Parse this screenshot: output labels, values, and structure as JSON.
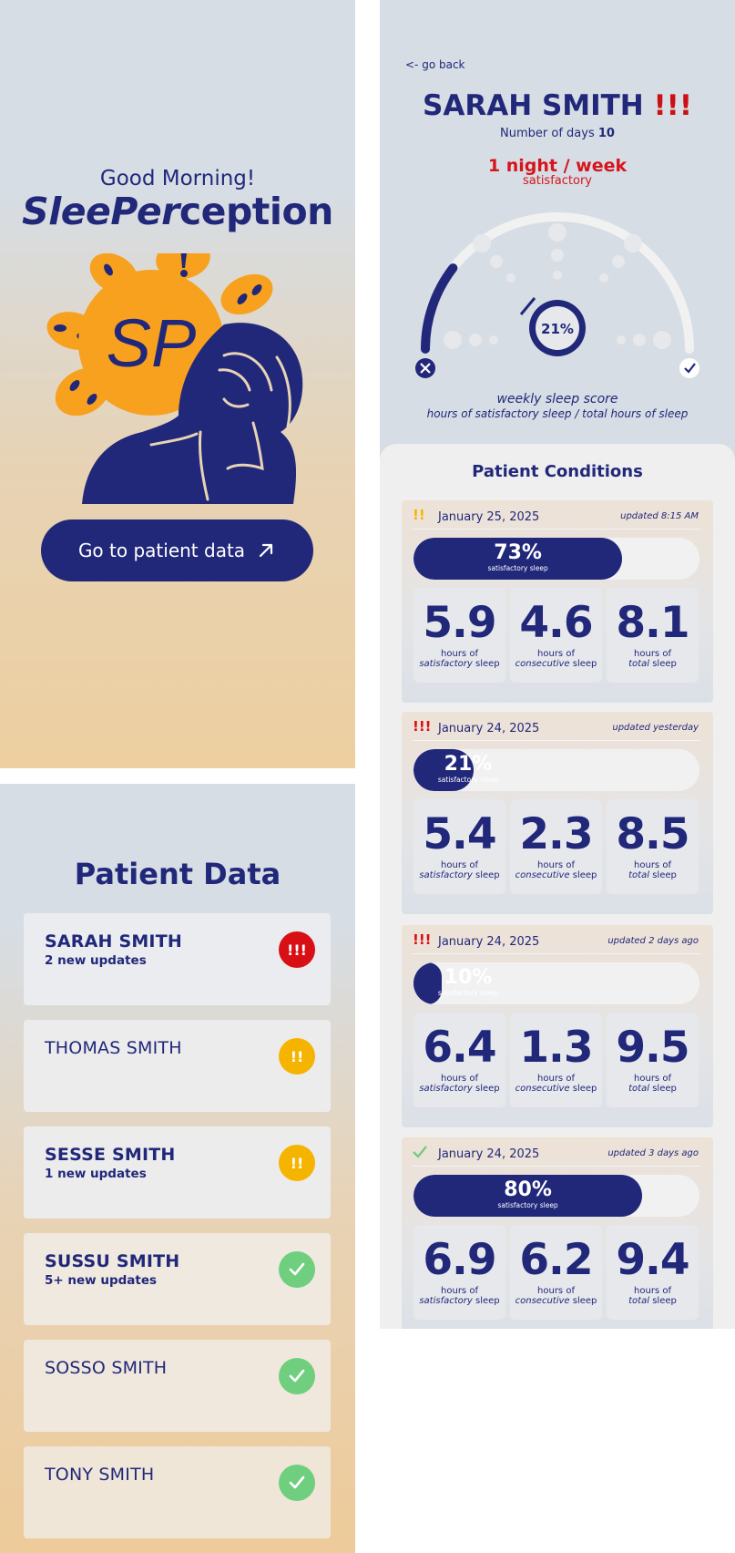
{
  "welcome": {
    "greeting": "Good Morning!",
    "brand_italic": "SleePer",
    "brand_rest": "ception",
    "logo_initials": "SP",
    "cta_label": "Go to patient data",
    "cta_icon": "arrow-up-right-icon"
  },
  "patient_list": {
    "title": "Patient Data",
    "patients": [
      {
        "name": "SARAH SMITH",
        "updates": "2 new updates",
        "status": "critical",
        "badge": "!!!"
      },
      {
        "name": "THOMAS SMITH",
        "updates": "",
        "status": "warning",
        "badge": "!!"
      },
      {
        "name": "SESSE SMITH",
        "updates": "1 new updates",
        "status": "warning",
        "badge": "!!"
      },
      {
        "name": "SUSSU SMITH",
        "updates": "5+ new updates",
        "status": "ok",
        "badge": "check-icon"
      },
      {
        "name": "SOSSO SMITH",
        "updates": "",
        "status": "ok",
        "badge": "check-icon"
      },
      {
        "name": "TONY SMITH",
        "updates": "",
        "status": "ok",
        "badge": "check-icon"
      }
    ]
  },
  "detail": {
    "back_label": "<- go back",
    "patient_name": "SARAH SMITH",
    "alert_marks": "!!!",
    "days_label": "Number of days",
    "days_value": "10",
    "frequency": "1 night / week",
    "frequency_status": "satisfactory",
    "gauge": {
      "score_percent": 21,
      "score_label": "21%",
      "min_icon": "close-icon",
      "max_icon": "check-icon"
    },
    "score_title": "weekly sleep score",
    "score_subtitle": "hours of satisfactory sleep / total hours of sleep",
    "conditions_title": "Patient Conditions",
    "caption_prefix": "hours of",
    "caption_suffix": "sleep",
    "entries": [
      {
        "status": "warning",
        "marks": "!!",
        "date": "January 25, 2025",
        "updated": "updated 8:15 AM",
        "percent": 73,
        "percent_label": "73%",
        "bar_caption": "satisfactory sleep",
        "stats": [
          {
            "value": "5.9",
            "kind": "satisfactory"
          },
          {
            "value": "4.6",
            "kind": "consecutive"
          },
          {
            "value": "8.1",
            "kind": "total"
          }
        ]
      },
      {
        "status": "critical",
        "marks": "!!!",
        "date": "January 24, 2025",
        "updated": "updated yesterday",
        "percent": 21,
        "percent_label": "21%",
        "bar_caption": "satisfactory sleep",
        "stats": [
          {
            "value": "5.4",
            "kind": "satisfactory"
          },
          {
            "value": "2.3",
            "kind": "consecutive"
          },
          {
            "value": "8.5",
            "kind": "total"
          }
        ]
      },
      {
        "status": "critical",
        "marks": "!!!",
        "date": "January 24, 2025",
        "updated": "updated 2 days ago",
        "percent": 10,
        "percent_label": "10%",
        "bar_caption": "satisfactory sleep",
        "stats": [
          {
            "value": "6.4",
            "kind": "satisfactory"
          },
          {
            "value": "1.3",
            "kind": "consecutive"
          },
          {
            "value": "9.5",
            "kind": "total"
          }
        ]
      },
      {
        "status": "ok",
        "marks": "check-icon",
        "date": "January 24, 2025",
        "updated": "updated 3 days ago",
        "percent": 80,
        "percent_label": "80%",
        "bar_caption": "satisfactory sleep",
        "stats": [
          {
            "value": "6.9",
            "kind": "satisfactory"
          },
          {
            "value": "6.2",
            "kind": "consecutive"
          },
          {
            "value": "9.4",
            "kind": "total"
          }
        ]
      }
    ]
  },
  "colors": {
    "navy": "#21287a",
    "orange": "#f7a11f",
    "critical": "#d80f14",
    "warning": "#f5b400",
    "ok": "#6fcf7f"
  }
}
